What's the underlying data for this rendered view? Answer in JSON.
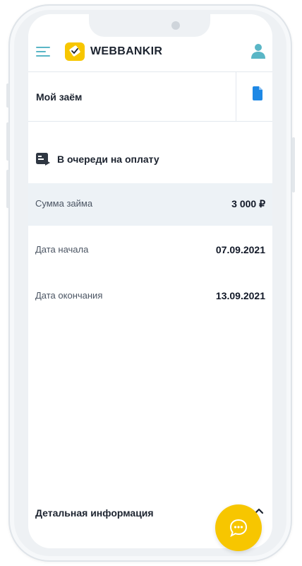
{
  "header": {
    "brand": "WEBBANKIR"
  },
  "loan": {
    "title": "Мой заём"
  },
  "status": {
    "label": "В очереди на оплату"
  },
  "details": [
    {
      "label": "Сумма займа",
      "value": "3 000 ₽"
    },
    {
      "label": "Дата начала",
      "value": "07.09.2021"
    },
    {
      "label": "Дата окончания",
      "value": "13.09.2021"
    }
  ],
  "detail_section": {
    "title": "Детальная информация"
  },
  "colors": {
    "accent": "#5ab6c6",
    "brand_yellow": "#f7c600",
    "doc_blue": "#1e88e5",
    "shaded_row": "#edf2f6"
  },
  "icons": [
    "menu-icon",
    "logo-icon",
    "user-icon",
    "document-icon",
    "queue-status-icon",
    "chevron-up-icon",
    "chat-icon"
  ]
}
